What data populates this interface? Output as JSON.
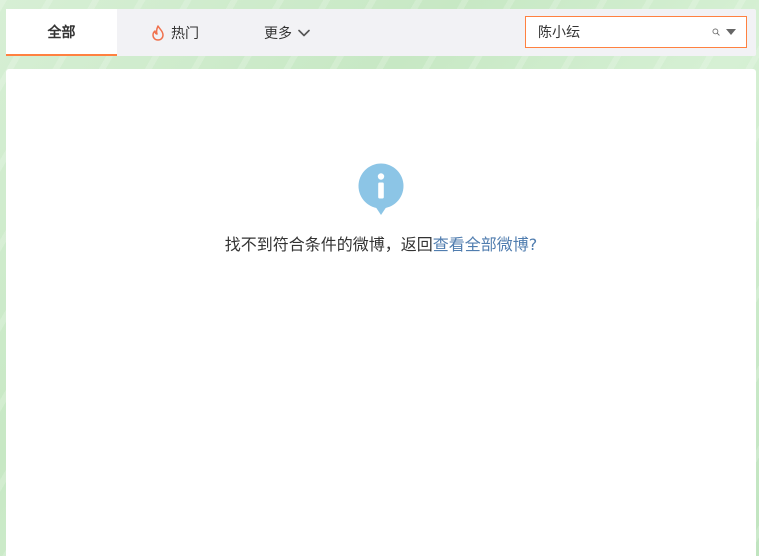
{
  "tabs": {
    "all_label": "全部",
    "hot_label": "热门",
    "more_label": "更多"
  },
  "search": {
    "value": "陈小纭"
  },
  "empty_state": {
    "message": "找不到符合条件的微博，返回",
    "link_text": "查看全部微博?"
  },
  "colors": {
    "accent": "#ff8140",
    "link": "#507daf",
    "info_icon": "#8cc5e6"
  },
  "icons": {
    "hot": "flame-icon",
    "more": "chevron-down-icon",
    "search": "search-icon",
    "info": "info-icon"
  }
}
